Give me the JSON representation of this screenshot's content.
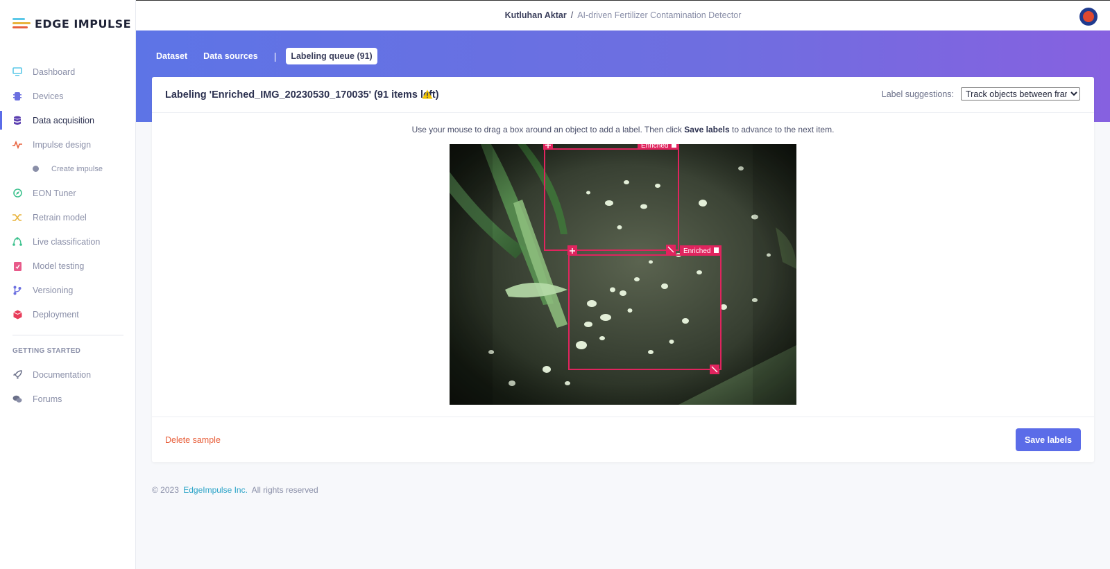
{
  "brand": {
    "name": "EDGE IMPULSE"
  },
  "sidebar": {
    "items": [
      {
        "label": "Dashboard",
        "icon": "monitor-icon",
        "color": "#5bc8e8"
      },
      {
        "label": "Devices",
        "icon": "cpu-icon",
        "color": "#6b6fe0"
      },
      {
        "label": "Data acquisition",
        "icon": "database-icon",
        "color": "#5b3fb0",
        "active": true
      },
      {
        "label": "Impulse design",
        "icon": "pulse-icon",
        "color": "#e8603c"
      },
      {
        "label": "EON Tuner",
        "icon": "compass-icon",
        "color": "#3ec28f"
      },
      {
        "label": "Retrain model",
        "icon": "shuffle-icon",
        "color": "#e8b33c"
      },
      {
        "label": "Live classification",
        "icon": "network-icon",
        "color": "#3ec28f"
      },
      {
        "label": "Model testing",
        "icon": "clipboard-check-icon",
        "color": "#e85a8a"
      },
      {
        "label": "Versioning",
        "icon": "git-branch-icon",
        "color": "#6b6fe0"
      },
      {
        "label": "Deployment",
        "icon": "cube-icon",
        "color": "#e83c5a"
      }
    ],
    "sub_item": "Create impulse",
    "section_label": "GETTING STARTED",
    "getting_started": [
      {
        "label": "Documentation",
        "icon": "rocket-icon"
      },
      {
        "label": "Forums",
        "icon": "chat-icon"
      }
    ]
  },
  "header": {
    "user": "Kutluhan Aktar",
    "separator": "/",
    "project": "AI-driven Fertilizer Contamination Detector"
  },
  "tabs": [
    {
      "label": "Dataset"
    },
    {
      "label": "Data sources"
    },
    {
      "label": "Labeling queue (91)",
      "active": true
    }
  ],
  "card": {
    "title": "Labeling 'Enriched_IMG_20230530_170035' (91 items left)",
    "suggestions_label": "Label suggestions:",
    "suggestions_value": "Track objects between frames",
    "instruction_pre": "Use your mouse to drag a box around an object to add a label. Then click ",
    "instruction_bold": "Save labels",
    "instruction_post": " to advance to the next item.",
    "boxes": [
      {
        "label": "Enriched"
      },
      {
        "label": "Enriched"
      }
    ],
    "delete_label": "Delete sample",
    "save_label": "Save labels"
  },
  "footer": {
    "copyright": "© 2023",
    "company": "EdgeImpulse Inc.",
    "rights": "All rights reserved"
  },
  "colors": {
    "accent": "#5b6ce8",
    "bbox": "#e0245e",
    "danger_link": "#e8603c",
    "warning": "#f2c200"
  }
}
